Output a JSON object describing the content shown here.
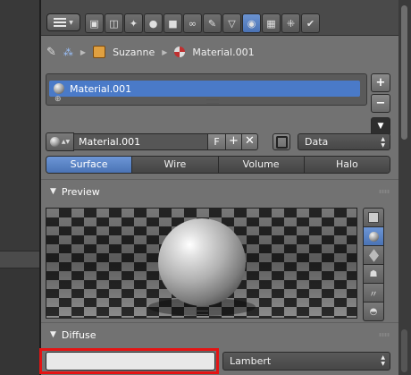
{
  "header": {
    "editor_icon": "properties-editor-icon",
    "tabs": [
      {
        "icon": "render-icon",
        "glyph": "▣"
      },
      {
        "icon": "render-layers-icon",
        "glyph": "◫"
      },
      {
        "icon": "scene-icon",
        "glyph": "✦"
      },
      {
        "icon": "world-icon",
        "glyph": "●"
      },
      {
        "icon": "object-icon",
        "glyph": "■"
      },
      {
        "icon": "constraints-icon",
        "glyph": "∞"
      },
      {
        "icon": "modifiers-icon",
        "glyph": "✎"
      },
      {
        "icon": "data-icon",
        "glyph": "▽"
      },
      {
        "icon": "material-icon",
        "glyph": "◉",
        "active": true
      },
      {
        "icon": "texture-icon",
        "glyph": "▦"
      },
      {
        "icon": "particles-icon",
        "glyph": "⁜"
      },
      {
        "icon": "physics-icon",
        "glyph": "✔"
      }
    ]
  },
  "breadcrumb": {
    "object_name": "Suzanne",
    "material_name": "Material.001"
  },
  "material_slots": {
    "items": [
      "Material.001"
    ],
    "add_label": "+",
    "remove_label": "−",
    "menu_label": "▼"
  },
  "datablock": {
    "name": "Material.001",
    "fake_user_label": "F",
    "new_label": "+",
    "unlink_label": "✕",
    "link_value": "Data"
  },
  "material_type_tabs": [
    "Surface",
    "Wire",
    "Volume",
    "Halo"
  ],
  "active_type": "Surface",
  "preview_panel": {
    "title": "Preview",
    "buttons": [
      "flat-preview-icon",
      "sphere-preview-icon",
      "cube-preview-icon",
      "monkey-preview-icon",
      "hair-preview-icon",
      "sky-sphere-preview-icon"
    ],
    "active_button": "sphere-preview-icon"
  },
  "diffuse_panel": {
    "title": "Diffuse",
    "color": "#e8e8e8",
    "shader_value": "Lambert"
  },
  "colors": {
    "accent": "#5680c2",
    "highlight_box": "#e41313"
  }
}
